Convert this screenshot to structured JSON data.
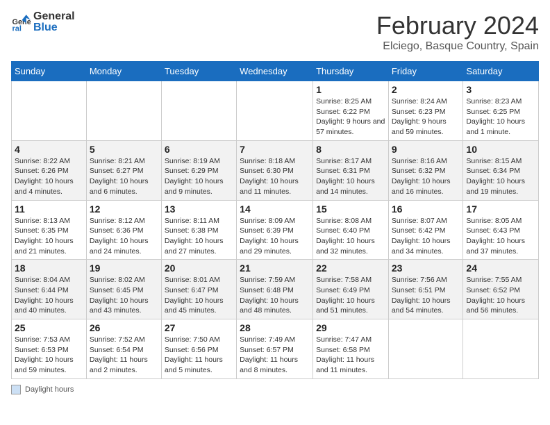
{
  "header": {
    "logo_general": "General",
    "logo_blue": "Blue",
    "month_title": "February 2024",
    "location": "Elciego, Basque Country, Spain"
  },
  "days_of_week": [
    "Sunday",
    "Monday",
    "Tuesday",
    "Wednesday",
    "Thursday",
    "Friday",
    "Saturday"
  ],
  "weeks": [
    [
      {
        "day": "",
        "info": ""
      },
      {
        "day": "",
        "info": ""
      },
      {
        "day": "",
        "info": ""
      },
      {
        "day": "",
        "info": ""
      },
      {
        "day": "1",
        "info": "Sunrise: 8:25 AM\nSunset: 6:22 PM\nDaylight: 9 hours and 57 minutes."
      },
      {
        "day": "2",
        "info": "Sunrise: 8:24 AM\nSunset: 6:23 PM\nDaylight: 9 hours and 59 minutes."
      },
      {
        "day": "3",
        "info": "Sunrise: 8:23 AM\nSunset: 6:25 PM\nDaylight: 10 hours and 1 minute."
      }
    ],
    [
      {
        "day": "4",
        "info": "Sunrise: 8:22 AM\nSunset: 6:26 PM\nDaylight: 10 hours and 4 minutes."
      },
      {
        "day": "5",
        "info": "Sunrise: 8:21 AM\nSunset: 6:27 PM\nDaylight: 10 hours and 6 minutes."
      },
      {
        "day": "6",
        "info": "Sunrise: 8:19 AM\nSunset: 6:29 PM\nDaylight: 10 hours and 9 minutes."
      },
      {
        "day": "7",
        "info": "Sunrise: 8:18 AM\nSunset: 6:30 PM\nDaylight: 10 hours and 11 minutes."
      },
      {
        "day": "8",
        "info": "Sunrise: 8:17 AM\nSunset: 6:31 PM\nDaylight: 10 hours and 14 minutes."
      },
      {
        "day": "9",
        "info": "Sunrise: 8:16 AM\nSunset: 6:32 PM\nDaylight: 10 hours and 16 minutes."
      },
      {
        "day": "10",
        "info": "Sunrise: 8:15 AM\nSunset: 6:34 PM\nDaylight: 10 hours and 19 minutes."
      }
    ],
    [
      {
        "day": "11",
        "info": "Sunrise: 8:13 AM\nSunset: 6:35 PM\nDaylight: 10 hours and 21 minutes."
      },
      {
        "day": "12",
        "info": "Sunrise: 8:12 AM\nSunset: 6:36 PM\nDaylight: 10 hours and 24 minutes."
      },
      {
        "day": "13",
        "info": "Sunrise: 8:11 AM\nSunset: 6:38 PM\nDaylight: 10 hours and 27 minutes."
      },
      {
        "day": "14",
        "info": "Sunrise: 8:09 AM\nSunset: 6:39 PM\nDaylight: 10 hours and 29 minutes."
      },
      {
        "day": "15",
        "info": "Sunrise: 8:08 AM\nSunset: 6:40 PM\nDaylight: 10 hours and 32 minutes."
      },
      {
        "day": "16",
        "info": "Sunrise: 8:07 AM\nSunset: 6:42 PM\nDaylight: 10 hours and 34 minutes."
      },
      {
        "day": "17",
        "info": "Sunrise: 8:05 AM\nSunset: 6:43 PM\nDaylight: 10 hours and 37 minutes."
      }
    ],
    [
      {
        "day": "18",
        "info": "Sunrise: 8:04 AM\nSunset: 6:44 PM\nDaylight: 10 hours and 40 minutes."
      },
      {
        "day": "19",
        "info": "Sunrise: 8:02 AM\nSunset: 6:45 PM\nDaylight: 10 hours and 43 minutes."
      },
      {
        "day": "20",
        "info": "Sunrise: 8:01 AM\nSunset: 6:47 PM\nDaylight: 10 hours and 45 minutes."
      },
      {
        "day": "21",
        "info": "Sunrise: 7:59 AM\nSunset: 6:48 PM\nDaylight: 10 hours and 48 minutes."
      },
      {
        "day": "22",
        "info": "Sunrise: 7:58 AM\nSunset: 6:49 PM\nDaylight: 10 hours and 51 minutes."
      },
      {
        "day": "23",
        "info": "Sunrise: 7:56 AM\nSunset: 6:51 PM\nDaylight: 10 hours and 54 minutes."
      },
      {
        "day": "24",
        "info": "Sunrise: 7:55 AM\nSunset: 6:52 PM\nDaylight: 10 hours and 56 minutes."
      }
    ],
    [
      {
        "day": "25",
        "info": "Sunrise: 7:53 AM\nSunset: 6:53 PM\nDaylight: 10 hours and 59 minutes."
      },
      {
        "day": "26",
        "info": "Sunrise: 7:52 AM\nSunset: 6:54 PM\nDaylight: 11 hours and 2 minutes."
      },
      {
        "day": "27",
        "info": "Sunrise: 7:50 AM\nSunset: 6:56 PM\nDaylight: 11 hours and 5 minutes."
      },
      {
        "day": "28",
        "info": "Sunrise: 7:49 AM\nSunset: 6:57 PM\nDaylight: 11 hours and 8 minutes."
      },
      {
        "day": "29",
        "info": "Sunrise: 7:47 AM\nSunset: 6:58 PM\nDaylight: 11 hours and 11 minutes."
      },
      {
        "day": "",
        "info": ""
      },
      {
        "day": "",
        "info": ""
      }
    ]
  ],
  "footer": {
    "box_label": "Daylight hours"
  }
}
